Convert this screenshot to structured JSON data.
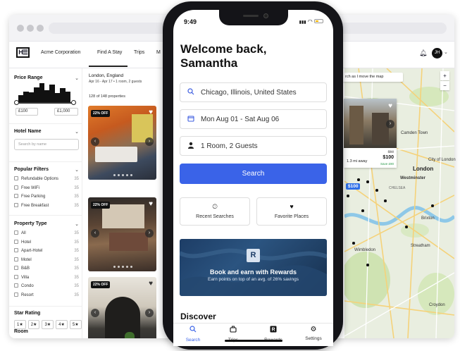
{
  "desktop": {
    "nav": {
      "logo_text": "H☰",
      "company": "Acme Corporation",
      "tabs": [
        "Find A Stay",
        "Trips",
        "M"
      ],
      "avatar_initials": "JH"
    },
    "filters": {
      "price_range": {
        "title": "Price Range",
        "min_value": "£100",
        "max_value": "£1,000",
        "histogram": [
          0.35,
          0.55,
          0.5,
          0.75,
          0.95,
          0.6,
          0.9,
          0.45,
          0.7,
          0.55
        ]
      },
      "hotel_name": {
        "title": "Hotel Name",
        "placeholder": "Search by name"
      },
      "popular_filters": {
        "title": "Popular Filters",
        "items": [
          {
            "label": "Refundable Options",
            "count": "35"
          },
          {
            "label": "Free WiFi",
            "count": "35"
          },
          {
            "label": "Free Parking",
            "count": "35"
          },
          {
            "label": "Free Breakfast",
            "count": "35"
          }
        ]
      },
      "property_type": {
        "title": "Property Type",
        "items": [
          {
            "label": "All",
            "count": "35"
          },
          {
            "label": "Hotel",
            "count": "35"
          },
          {
            "label": "Apart-Hotel",
            "count": "35"
          },
          {
            "label": "Motel",
            "count": "35"
          },
          {
            "label": "B&B",
            "count": "35"
          },
          {
            "label": "Villa",
            "count": "35"
          },
          {
            "label": "Condo",
            "count": "35"
          },
          {
            "label": "Resort",
            "count": "35"
          }
        ]
      },
      "star_rating": {
        "title": "Star Rating",
        "options": [
          "1★",
          "2★",
          "3★",
          "4★",
          "5★"
        ]
      },
      "room": {
        "title": "Room"
      }
    },
    "listings": {
      "city": "London, England",
      "dates": "Apr 16 - Apr 17 • 1 room, 2 guests",
      "count": "128 of 148 properties",
      "cards": [
        {
          "badge": "22% OFF"
        },
        {
          "badge": "22% OFF"
        },
        {
          "badge": "22% OFF"
        }
      ]
    },
    "map": {
      "search_toggle": "rch as I move the map",
      "zoom_in": "+",
      "zoom_out": "−",
      "labels": {
        "camden": "Camden Town",
        "city": "City of London",
        "london": "London",
        "westminster": "Westminster",
        "chelsea": "CHELSEA",
        "brixton": "Brixton",
        "wimbledon": "Wimbledon",
        "streatham": "Streatham",
        "croydon": "Croydon"
      },
      "price_pin": "$100",
      "hotel_card": {
        "distance": "1.3 mi away",
        "old_price": "$50",
        "price": "$100",
        "save": "Save £90"
      }
    }
  },
  "phone": {
    "status": {
      "time": "9:49",
      "signal": "▮▮▮",
      "wifi": "◠"
    },
    "welcome_line1": "Welcome back,",
    "welcome_line2": "Samantha",
    "location": "Chicago, Illinois, United States",
    "dates": "Mon Aug 01 - Sat Aug 06",
    "guests": "1 Room, 2 Guests",
    "search_label": "Search",
    "recent_searches": "Recent Searches",
    "favorite_places": "Favorite Places",
    "banner": {
      "logo": "R",
      "title": "Book and earn with Rewards",
      "subtitle": "Earn points on top of an avg. of 26% savings"
    },
    "discover": "Discover",
    "tabs": [
      "Search",
      "Trips",
      "Rewards",
      "Settings"
    ],
    "icons": {
      "location": "search-icon",
      "dates": "calendar-icon",
      "guests": "person-icon",
      "recent": "clock-icon",
      "favorites": "heart-icon",
      "tab_search": "search-icon",
      "tab_trips": "suitcase-icon",
      "tab_rewards": "rewards-icon",
      "tab_settings": "gear-icon"
    },
    "colors": {
      "accent": "#3a63e8",
      "banner": "#1d3d66"
    }
  }
}
